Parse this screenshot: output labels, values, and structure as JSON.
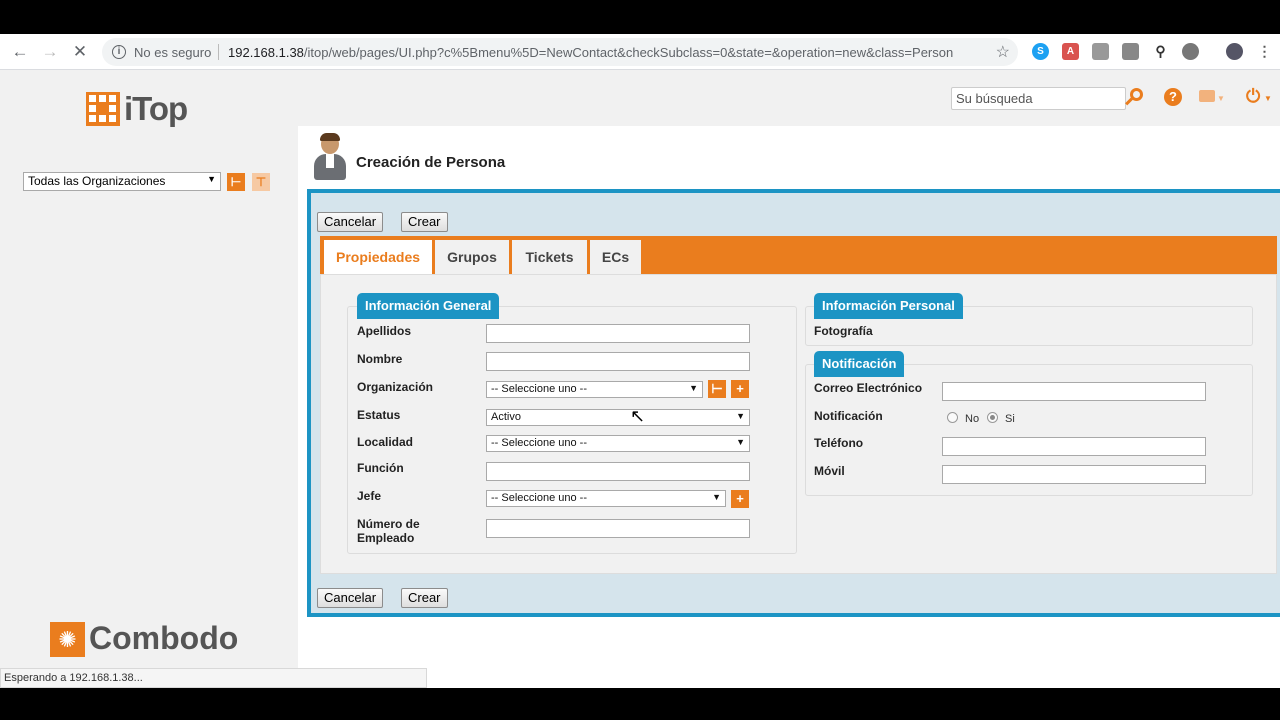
{
  "browser": {
    "not_secure": "No es seguro",
    "url_host": "192.168.1.38",
    "url_path": "/itop/web/pages/UI.php?c%5Bmenu%5D=NewContact&checkSubclass=0&state=&operation=new&class=Person",
    "status": "Esperando a 192.168.1.38..."
  },
  "app": {
    "logo": "iTop",
    "vendor": "Combodo",
    "org_filter": "Todas las Organizaciones",
    "search_placeholder": "Su búsqueda"
  },
  "page": {
    "title": "Creación de Persona",
    "cancel_label": "Cancelar",
    "create_label": "Crear"
  },
  "tabs": [
    {
      "label": "Propiedades",
      "active": true
    },
    {
      "label": "Grupos",
      "active": false
    },
    {
      "label": "Tickets",
      "active": false
    },
    {
      "label": "ECs",
      "active": false
    }
  ],
  "general": {
    "legend": "Información General",
    "apellidos": "Apellidos",
    "nombre": "Nombre",
    "organizacion": "Organización",
    "organizacion_value": "-- Seleccione uno --",
    "estatus": "Estatus",
    "estatus_value": "Activo",
    "localidad": "Localidad",
    "localidad_value": "-- Seleccione uno --",
    "funcion": "Función",
    "jefe": "Jefe",
    "jefe_value": "-- Seleccione uno --",
    "numero_empleado": "Número de Empleado"
  },
  "personal": {
    "legend": "Información Personal",
    "fotografia": "Fotografía"
  },
  "notificacion": {
    "legend": "Notificación",
    "correo": "Correo Electrónico",
    "notificacion": "Notificación",
    "opt_no": "No",
    "opt_si": "Si",
    "selected": "Si",
    "telefono": "Teléfono",
    "movil": "Móvil"
  },
  "colors": {
    "accent": "#ea7d1e",
    "blue": "#1c94c4"
  }
}
